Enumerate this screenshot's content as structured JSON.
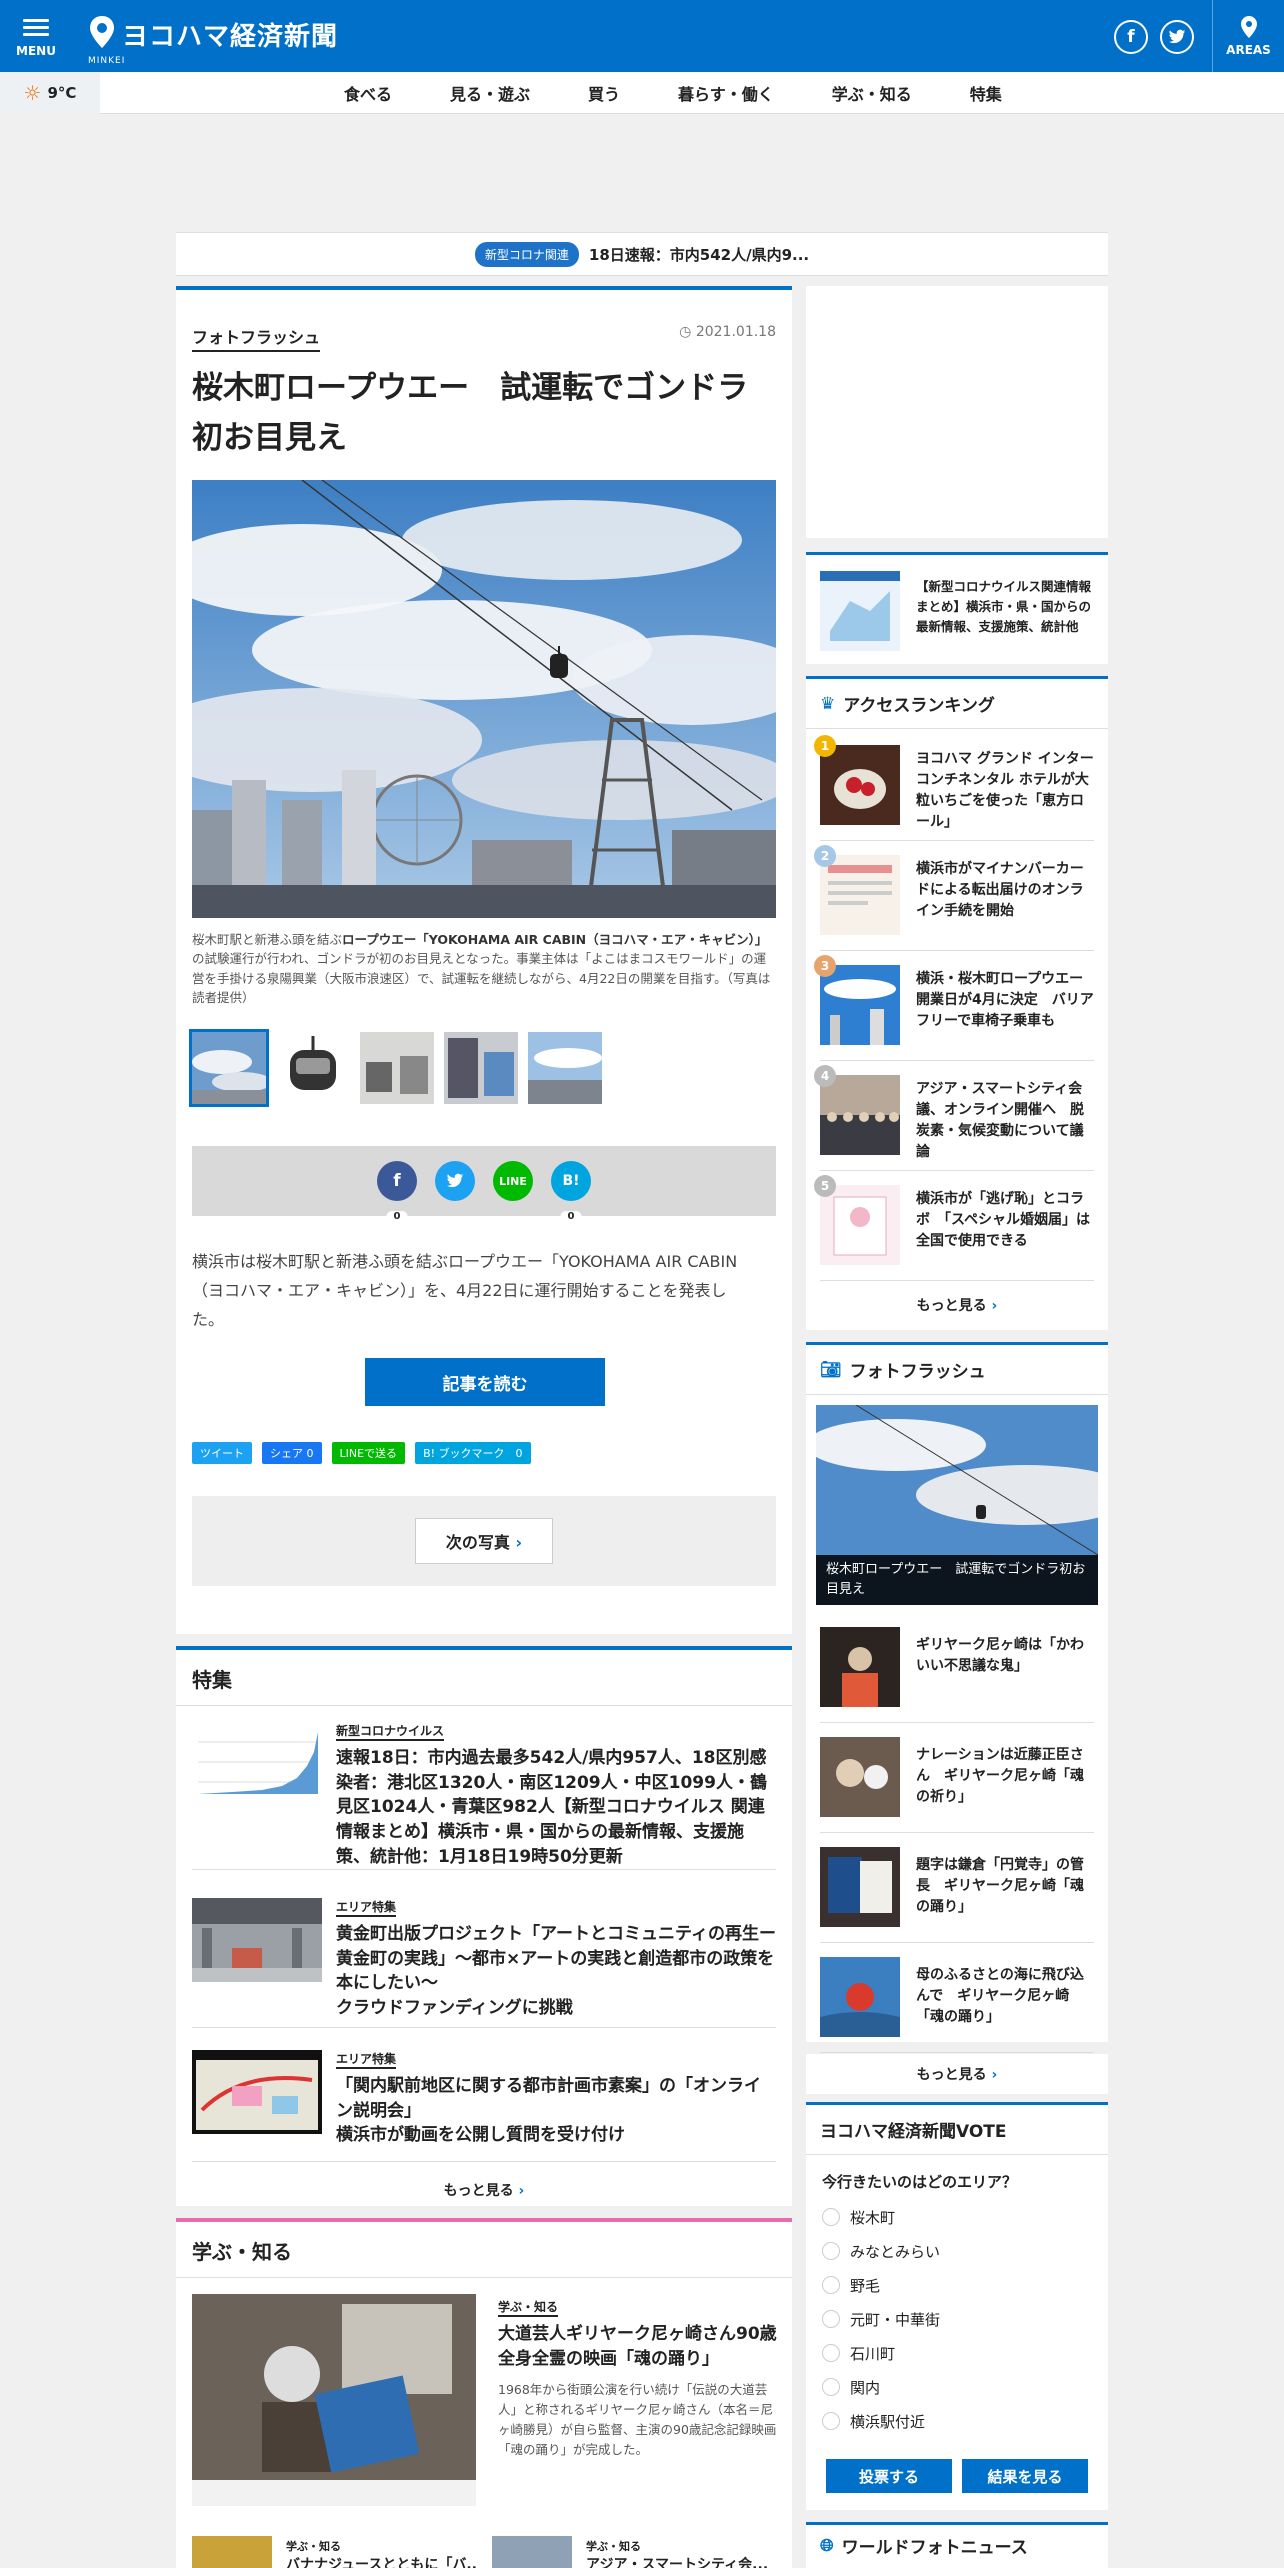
{
  "header": {
    "menu_label": "MENU",
    "site_name": "ヨコハマ経済新聞",
    "minkei_label": "MINKEI",
    "areas_label": "AREAS",
    "facebook_glyph": "f",
    "twitter_glyph": "t"
  },
  "weather": {
    "temp": "9°C",
    "icon": "sun-icon"
  },
  "nav": {
    "items": [
      "食べる",
      "見る・遊ぶ",
      "買う",
      "暮らす・働く",
      "学ぶ・知る",
      "特集"
    ]
  },
  "ticker": {
    "badge": "新型コロナ関連",
    "text": "18日速報：市内542人/県内9..."
  },
  "article": {
    "category": "フォトフラッシュ",
    "date": "2021.01.18",
    "title": "桜木町ロープウエー　試運転でゴンドラ初お目見え",
    "caption_pre": "桜木町駅と新港ふ頭を結ぶ",
    "caption_bold": "ロープウエー「YOKOHAMA AIR CABIN（ヨコハマ・エア・キャビン）」",
    "caption_post": "の試験運行が行われ、ゴンドラが初のお目見えとなった。事業主体は「よこはまコスモワールド」の運営を手掛ける泉陽興業（大阪市浪速区）で、試運転を継続しながら、4月22日の開業を目指す。（写真は読者提供）",
    "share": {
      "facebook": "f",
      "facebook_count": "0",
      "twitter": "t",
      "line": "LINE",
      "hatena": "B!",
      "hatena_count": "0"
    },
    "lead": "横浜市は桜木町駅と新港ふ頭を結ぶロープウエー「YOKOHAMA AIR CABIN（ヨコハマ・エア・キャビン）」を、4月22日に運行開始することを発表した。",
    "read_button": "記事を読む",
    "small_share": {
      "tweet": "ツイート",
      "fb_share": "シェア 0",
      "line_send": "LINEで送る",
      "bookmark": "B! ブックマーク　0"
    },
    "next_photo": "次の写真"
  },
  "feature": {
    "title": "特集",
    "items": [
      {
        "category": "新型コロナウイルス",
        "title": "速報18日：市内過去最多542人/県内957人、18区別感染者：港北区1320人・南区1209人・中区1099人・鶴見区1024人・青葉区982人【新型コロナウイルス 関連情報まとめ】横浜市・県・国からの最新情報、支援施策、統計他：1月18日19時50分更新"
      },
      {
        "category": "エリア特集",
        "title": "黄金町出版プロジェクト「アートとコミュニティの再生ー黄金町の実践」～都市×アートの実践と創造都市の政策を本にしたい～\nクラウドファンディングに挑戦"
      },
      {
        "category": "エリア特集",
        "title": "「関内駅前地区に関する都市計画市素案」の「オンライン説明会」\n横浜市が動画を公開し質問を受け付け"
      }
    ],
    "more": "もっと見る"
  },
  "manabu": {
    "title": "学ぶ・知る",
    "main": {
      "category": "学ぶ・知る",
      "title": "大道芸人ギリヤーク尼ヶ崎さん90歳　全身全霊の映画「魂の踊り」",
      "desc": "1968年から街頭公演を行い続け「伝説の大道芸人」と称されるギリヤーク尼ヶ崎さん（本名＝尼ヶ崎勝見）が自ら監督、主演の90歳記念記録映画「魂の踊り」が完成した。"
    },
    "sub1": {
      "category": "学ぶ・知る",
      "title": "バナナジュースとともに「バ..."
    },
    "sub2": {
      "category": "学ぶ・知る",
      "title": "アジア・スマートシティ会..."
    }
  },
  "side": {
    "promo": "【新型コロナウイルス関連情報まとめ】横浜市・県・国からの最新情報、支援施策、統計他",
    "ranking_title": "アクセスランキング",
    "ranking": [
      {
        "num": "1",
        "title": "ヨコハマ グランド インターコンチネンタル ホテルが大粒いちごを使った「恵方ロール」"
      },
      {
        "num": "2",
        "title": "横浜市がマイナンバーカードによる転出届けのオンライン手続を開始"
      },
      {
        "num": "3",
        "title": "横浜・桜木町ロープウエー開業日が4月に決定　バリアフリーで車椅子乗車も"
      },
      {
        "num": "4",
        "title": "アジア・スマートシティ会議、オンライン開催へ　脱炭素・気候変動について議論"
      },
      {
        "num": "5",
        "title": "横浜市が「逃げ恥」とコラボ　「スペシャル婚姻届」は全国で使用できる"
      }
    ],
    "more": "もっと見る",
    "photo_title": "フォトフラッシュ",
    "photo_caption": "桜木町ロープウエー　試運転でゴンドラ初お目見え",
    "photos": [
      "ギリヤーク尼ヶ崎は「かわいい不思議な鬼」",
      "ナレーションは近藤正臣さん　ギリヤーク尼ヶ崎「魂の祈り」",
      "題字は鎌倉「円覚寺」の管長　ギリヤーク尼ヶ崎「魂の踊り」",
      "母のふるさとの海に飛び込んで　ギリヤーク尼ヶ崎「魂の踊り」"
    ],
    "vote_title": "ヨコハマ経済新聞VOTE",
    "vote_question": "今行きたいのはどのエリア？",
    "vote_options": [
      "桜木町",
      "みなとみらい",
      "野毛",
      "元町・中華街",
      "石川町",
      "関内",
      "横浜駅付近"
    ],
    "vote_button": "投票する",
    "result_button": "結果を見る",
    "world_title": "ワールドフォトニュース"
  },
  "colors": {
    "brand": "#0070c9",
    "manabu_accent": "#e66cae",
    "rank1": "#f2b600",
    "rank2": "#a7c7e7",
    "rank3": "#e5a36d",
    "rank4": "#bbbbbb",
    "rank5": "#bbbbbb"
  }
}
